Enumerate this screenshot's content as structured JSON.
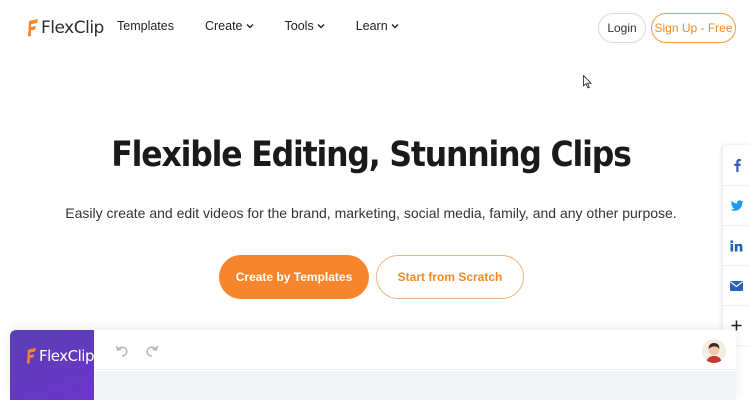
{
  "brand": {
    "name": "FlexClip",
    "accent": "#f7852c",
    "editor_purple": "#5b3fb5"
  },
  "nav": {
    "items": [
      {
        "label": "Templates",
        "dropdown": false
      },
      {
        "label": "Create",
        "dropdown": true
      },
      {
        "label": "Tools",
        "dropdown": true
      },
      {
        "label": "Learn",
        "dropdown": true
      }
    ],
    "login_label": "Login",
    "signup_label": "Sign Up - Free"
  },
  "hero": {
    "title": "Flexible Editing, Stunning Clips",
    "subtitle": "Easily create and edit videos for the brand, marketing, social media, family, and any other purpose.",
    "primary_cta": "Create by Templates",
    "secondary_cta": "Start from Scratch"
  },
  "share": {
    "icons": [
      "facebook-icon",
      "twitter-icon",
      "linkedin-icon",
      "email-icon",
      "plus-icon"
    ]
  },
  "editor": {
    "logo": "FlexClip",
    "toolbar_icons": [
      "undo-icon",
      "redo-icon"
    ],
    "avatar": "user-avatar"
  }
}
